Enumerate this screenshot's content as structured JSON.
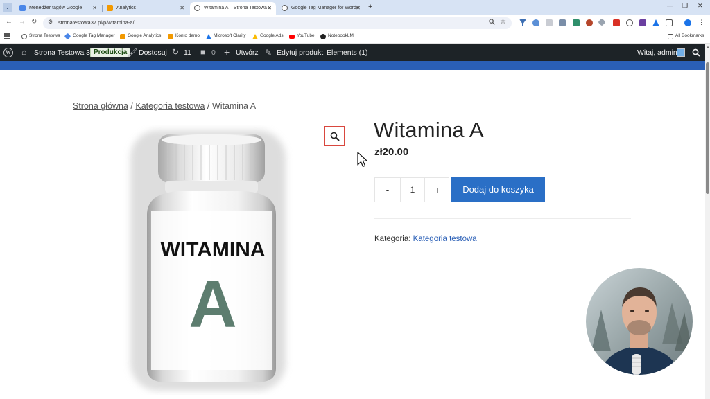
{
  "browser": {
    "tabs": [
      {
        "title": "Menedżer tagów Google",
        "active": false
      },
      {
        "title": "Analytics",
        "active": false
      },
      {
        "title": "Witamina A – Strona Testowa 3",
        "active": true
      },
      {
        "title": "Google Tag Manager for WordP",
        "active": false
      }
    ],
    "url": "stronatestowa37.pl/p/witamina-a/",
    "bookmarks": [
      "Strona Testowa",
      "Google Tag Manager",
      "Google Analytics",
      "Konto demo",
      "Microsoft Clarity",
      "Google Ads",
      "YouTube",
      "NotebookLM"
    ],
    "all_bookmarks": "All Bookmarks"
  },
  "admin_bar": {
    "site_name": "Strona Testowa 37",
    "env_badge": "Produkcja",
    "customize": "Dostosuj",
    "updates_count": "11",
    "comments_count": "0",
    "new_label": "Utwórz",
    "edit_product": "Edytuj produkt",
    "elements": "Elements (1)",
    "greeting": "Witaj, admin"
  },
  "breadcrumb": {
    "home": "Strona główna",
    "category": "Kategoria testowa",
    "current": "Witamina A",
    "separator": "/"
  },
  "product": {
    "title": "Witamina A",
    "price": "zł20.00",
    "image_text_line1": "WITAMINA",
    "image_text_line2": "A",
    "quantity": "1",
    "minus": "-",
    "plus": "+",
    "add_to_cart": "Dodaj do koszyka",
    "category_label": "Kategoria:",
    "category_link": "Kategoria testowa"
  }
}
